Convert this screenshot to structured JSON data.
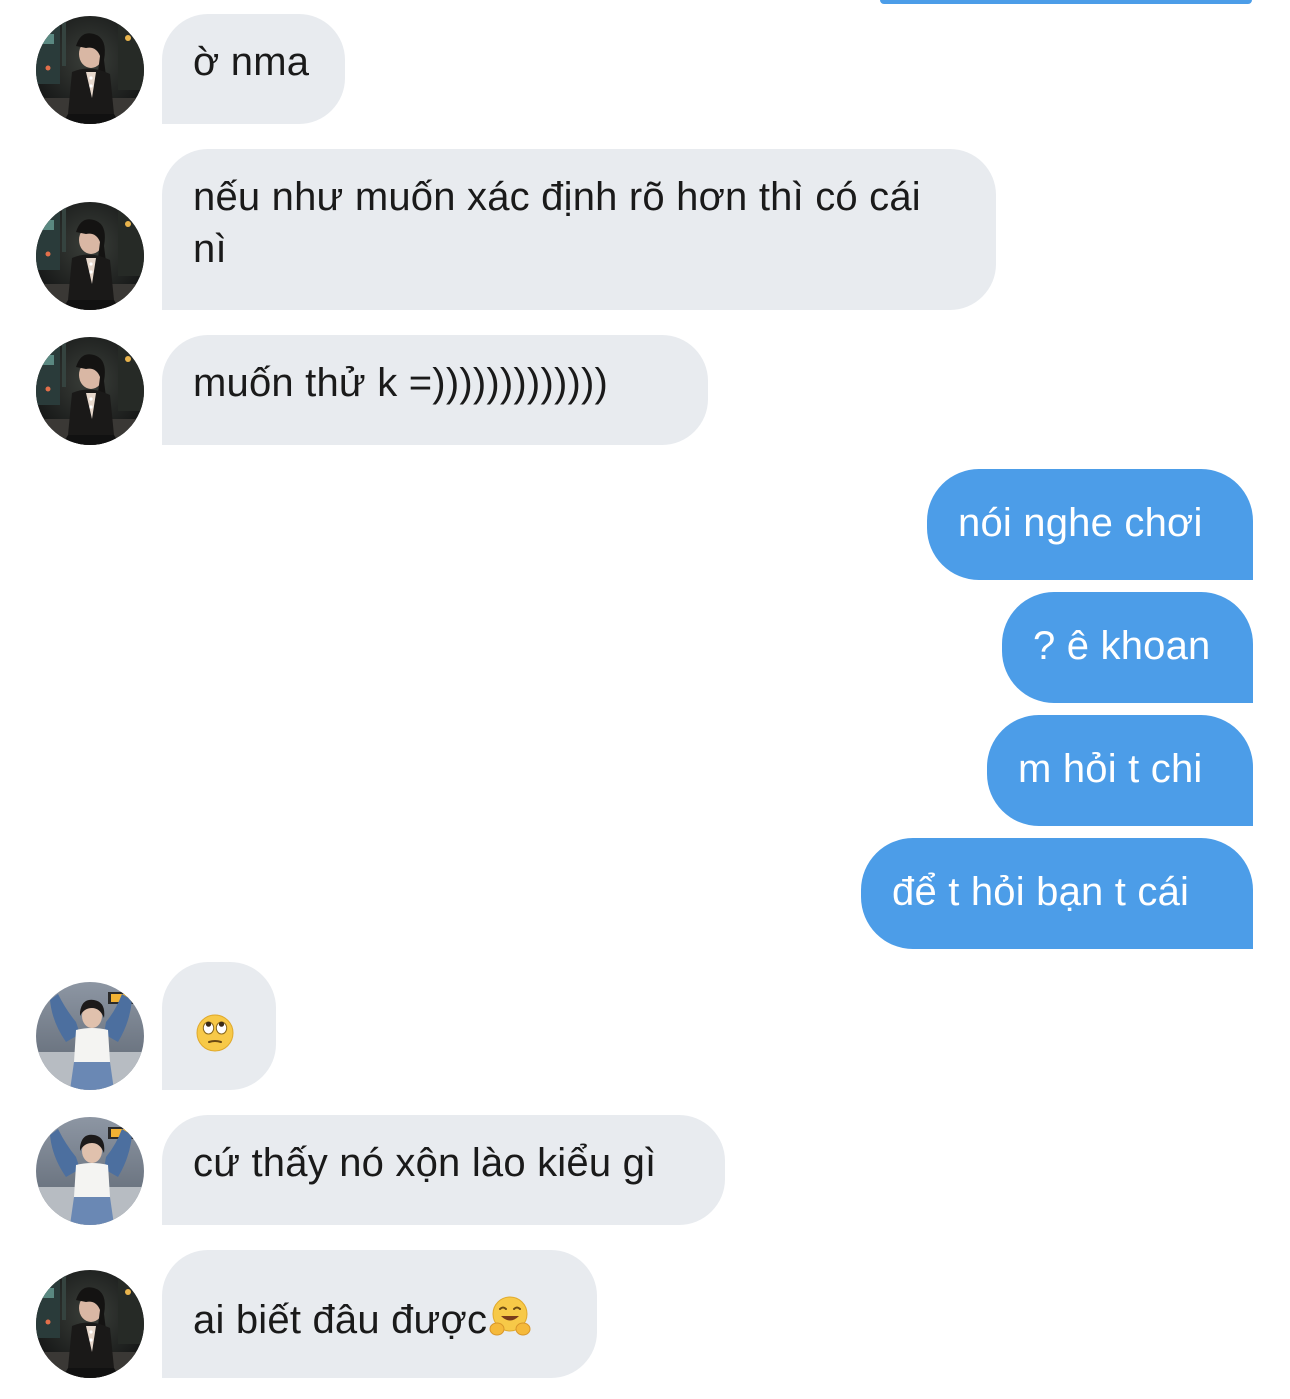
{
  "colors": {
    "incoming_bubble": "#e8ebef",
    "outgoing_bubble": "#4c9de8",
    "incoming_text": "#1a1a1a",
    "outgoing_text": "#ffffff"
  },
  "messages": [
    {
      "sender": "contact-a",
      "direction": "incoming",
      "text": "ờ nma"
    },
    {
      "sender": "contact-a",
      "direction": "incoming",
      "text": "nếu như muốn xác định rõ hơn thì có cái nì"
    },
    {
      "sender": "contact-a",
      "direction": "incoming",
      "text": "muốn thử k =)))))))))))))"
    },
    {
      "sender": "me",
      "direction": "outgoing",
      "text": "nói nghe chơi"
    },
    {
      "sender": "me",
      "direction": "outgoing",
      "text": "? ê khoan"
    },
    {
      "sender": "me",
      "direction": "outgoing",
      "text": "m hỏi t chi"
    },
    {
      "sender": "me",
      "direction": "outgoing",
      "text": "để t hỏi bạn t cái"
    },
    {
      "sender": "contact-b",
      "direction": "incoming",
      "text": "",
      "emoji": "face-with-rolling-eyes-emoji"
    },
    {
      "sender": "contact-b",
      "direction": "incoming",
      "text": "cứ thấy nó xộn lào kiểu gì"
    },
    {
      "sender": "contact-a",
      "direction": "incoming",
      "text": "ai biết đâu được",
      "emoji": "hugging-face-emoji"
    }
  ]
}
